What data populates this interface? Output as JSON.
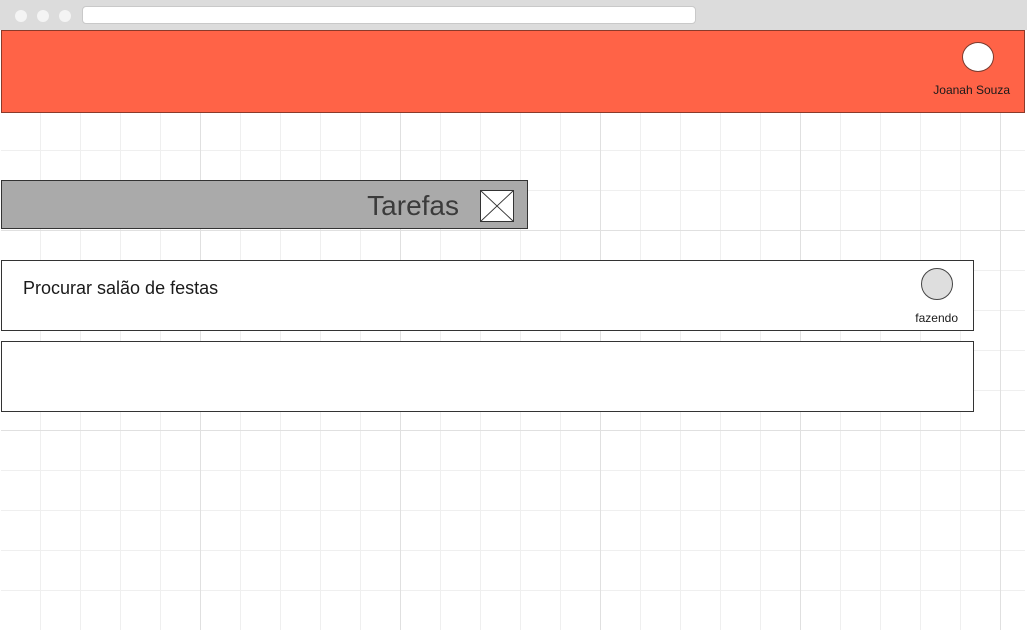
{
  "header": {
    "user_name": "Joanah Souza"
  },
  "section": {
    "title": "Tarefas"
  },
  "tasks": [
    {
      "title": "Procurar salão de festas",
      "status": "fazendo"
    },
    {
      "title": "",
      "status": ""
    }
  ],
  "colors": {
    "header_accent": "#ff6347",
    "title_bar": "#aaaaaa",
    "status_indicator": "#dedede"
  }
}
